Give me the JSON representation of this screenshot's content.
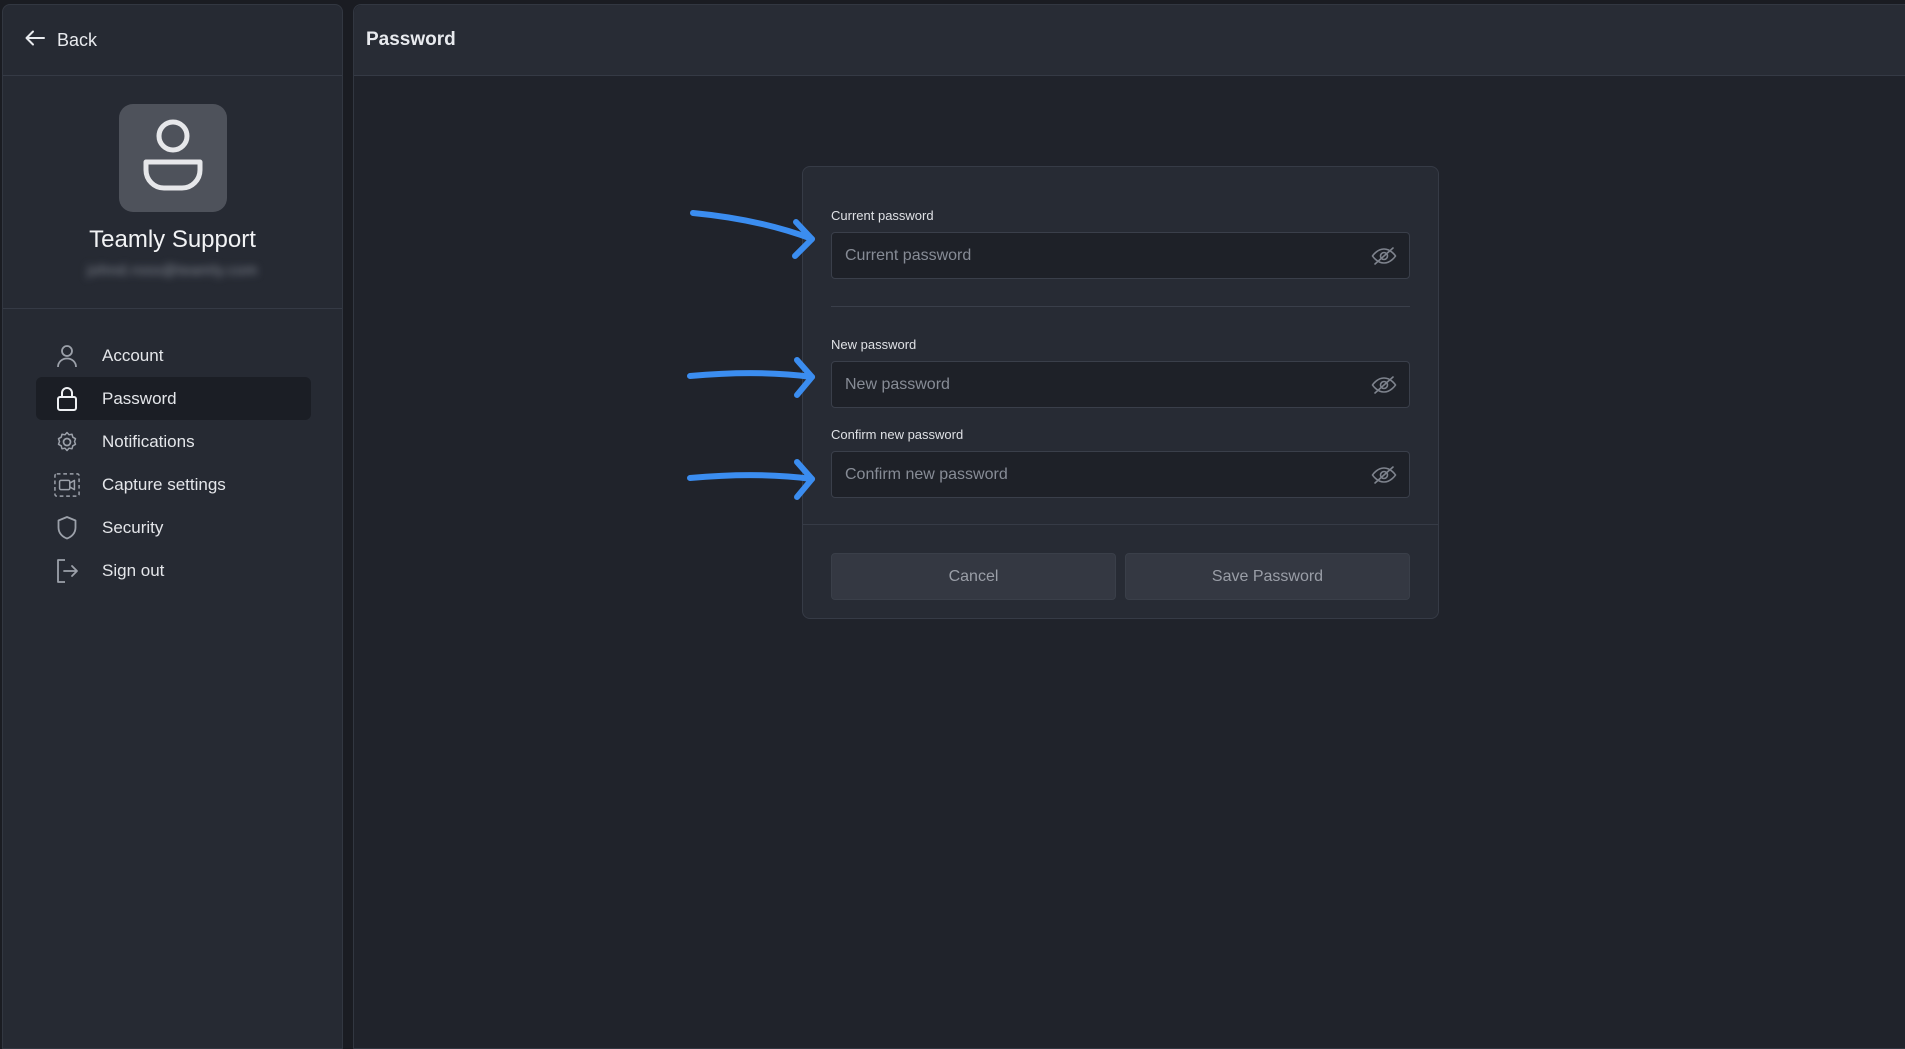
{
  "sidebar": {
    "back_label": "Back",
    "profile": {
      "name": "Teamly Support",
      "email": "johnd.ross@teamly.com"
    },
    "items": [
      {
        "label": "Account",
        "icon": "user-icon",
        "active": false
      },
      {
        "label": "Password",
        "icon": "lock-icon",
        "active": true
      },
      {
        "label": "Notifications",
        "icon": "gear-icon",
        "active": false
      },
      {
        "label": "Capture settings",
        "icon": "video-capture-icon",
        "active": false
      },
      {
        "label": "Security",
        "icon": "shield-icon",
        "active": false
      },
      {
        "label": "Sign out",
        "icon": "sign-out-icon",
        "active": false
      }
    ]
  },
  "main": {
    "title": "Password",
    "form": {
      "current": {
        "label": "Current password",
        "placeholder": "Current password",
        "value": ""
      },
      "new": {
        "label": "New password",
        "placeholder": "New password",
        "value": ""
      },
      "confirm": {
        "label": "Confirm new password",
        "placeholder": "Confirm new password",
        "value": ""
      },
      "cancel_label": "Cancel",
      "save_label": "Save Password"
    }
  },
  "annotations": {
    "arrow_color": "#3b8df0",
    "arrow_count": 3
  },
  "colors": {
    "background": "#1a1c22",
    "sidebar": "#262a33",
    "card": "#272b34",
    "input": "#1e2128"
  }
}
